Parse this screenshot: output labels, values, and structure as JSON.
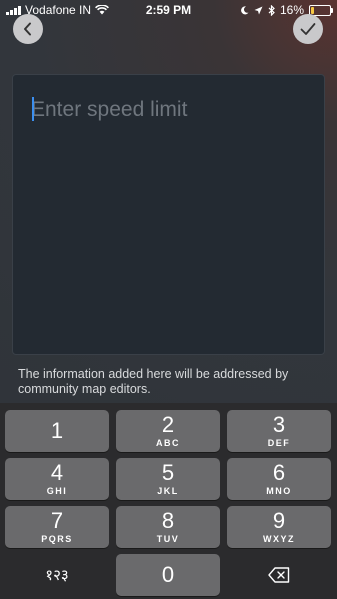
{
  "status_bar": {
    "carrier": "Vodafone IN",
    "time": "2:59 PM",
    "battery": "16%",
    "battery_level": 0.16
  },
  "top_bar": {
    "back_icon": "chevron-left-icon",
    "confirm_icon": "checkmark-icon"
  },
  "form": {
    "placeholder": "Enter speed limit",
    "info_text": "The information added here will be addressed by community map editors."
  },
  "keypad": {
    "keys": [
      {
        "num": "1",
        "letters": ""
      },
      {
        "num": "2",
        "letters": "ABC"
      },
      {
        "num": "3",
        "letters": "DEF"
      },
      {
        "num": "4",
        "letters": "GHI"
      },
      {
        "num": "5",
        "letters": "JKL"
      },
      {
        "num": "6",
        "letters": "MNO"
      },
      {
        "num": "7",
        "letters": "PQRS"
      },
      {
        "num": "8",
        "letters": "TUV"
      },
      {
        "num": "9",
        "letters": "WXYZ"
      }
    ],
    "alt_label": "१२३",
    "zero": "0",
    "delete_icon": "backspace-icon"
  }
}
